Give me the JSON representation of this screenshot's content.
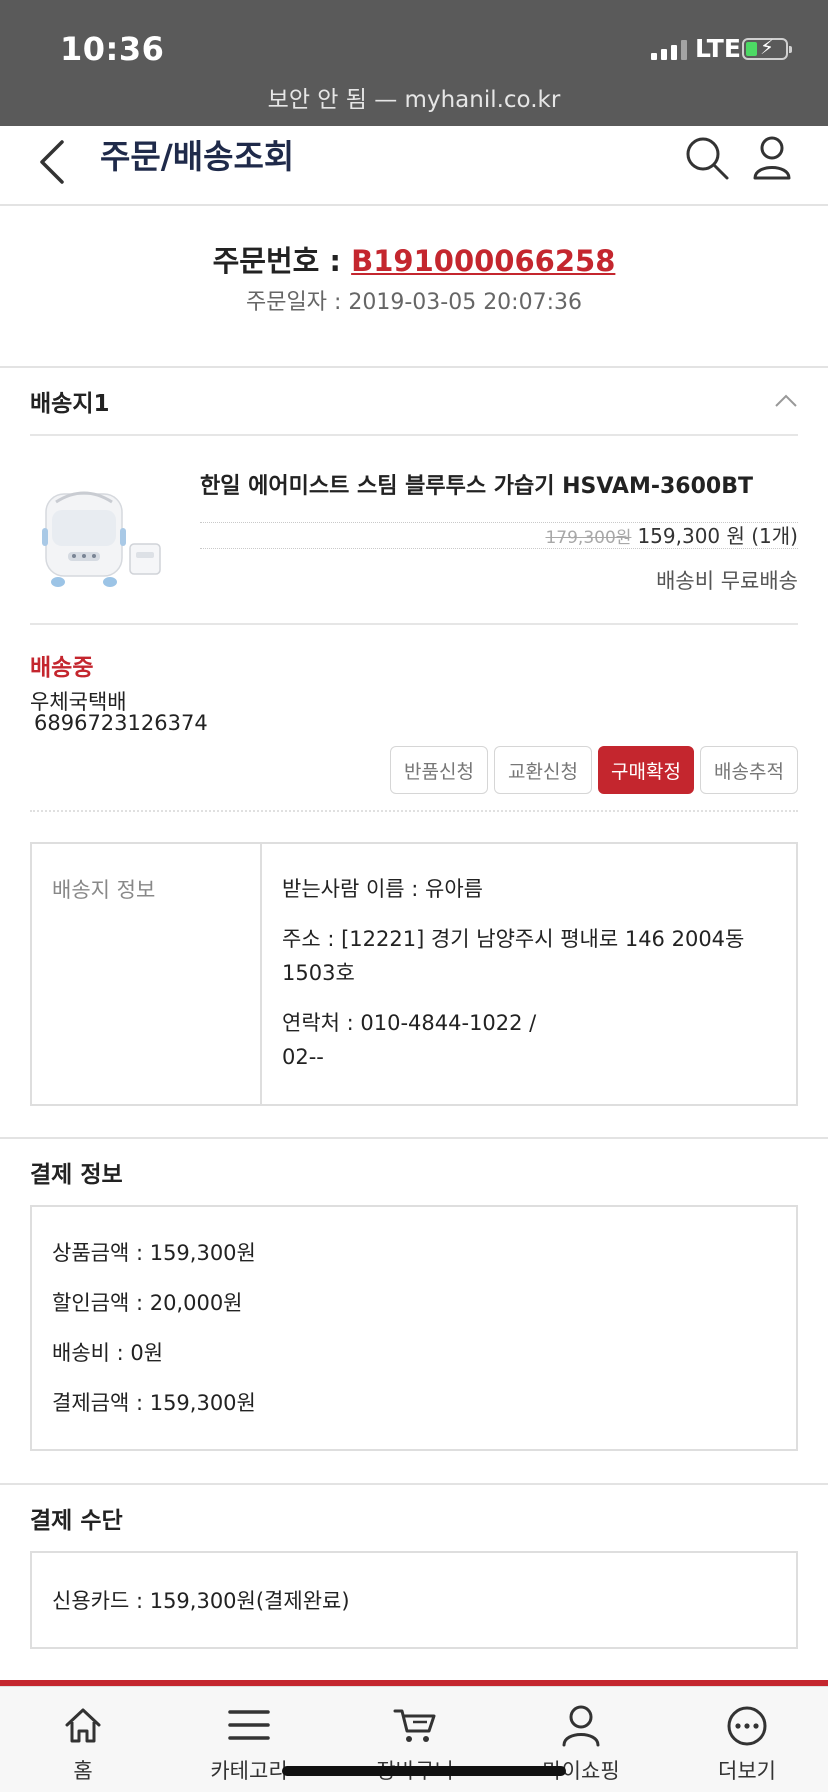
{
  "status_bar": {
    "time": "10:36",
    "network": "LTE",
    "url": "보안 안 됨 — myhanil.co.kr"
  },
  "header": {
    "title": "주문/배송조회"
  },
  "order": {
    "number_label": "주문번호 : ",
    "number": "B191000066258",
    "date": "주문일자 : 2019-03-05 20:07:36"
  },
  "shipment": {
    "title": "배송지1",
    "product_name": "한일 에어미스트 스팀 블루투스 가습기 HSVAM-3600BT",
    "original_price": "179,300원",
    "price": "159,300 원 (1개)",
    "shipping_fee": "배송비 무료배송",
    "status": "배송중",
    "carrier": "우체국택배",
    "tracking_number": "6896723126374",
    "buttons": [
      "반품신청",
      "교환신청",
      "구매확정",
      "배송추적"
    ]
  },
  "address_info": {
    "label": "배송지 정보",
    "recipient": "받는사람 이름 : 유아름",
    "address": "주소 : [12221] 경기 남양주시 평내로 146 2004동 1503호",
    "contact_line1": "연락처 : 010-4844-1022 /",
    "contact_line2": "02--"
  },
  "payment_info": {
    "title": "결제 정보",
    "product_amount": "상품금액 : 159,300원",
    "discount_amount": "할인금액 : 20,000원",
    "shipping_cost": "배송비 : 0원",
    "total_amount": "결제금액 : 159,300원"
  },
  "payment_method": {
    "title": "결제 수단",
    "detail": "신용카드 : 159,300원(결제완료)"
  },
  "tab_bar": {
    "items": [
      {
        "label": "홈",
        "icon": "home-icon"
      },
      {
        "label": "카테고리",
        "icon": "menu-icon"
      },
      {
        "label": "장바구니",
        "icon": "cart-icon"
      },
      {
        "label": "마이쇼핑",
        "icon": "user-icon"
      },
      {
        "label": "더보기",
        "icon": "more-icon"
      }
    ]
  },
  "colors": {
    "accent": "#c4262e",
    "title": "#1f2a4a",
    "status_bar": "#5a5a5a"
  }
}
